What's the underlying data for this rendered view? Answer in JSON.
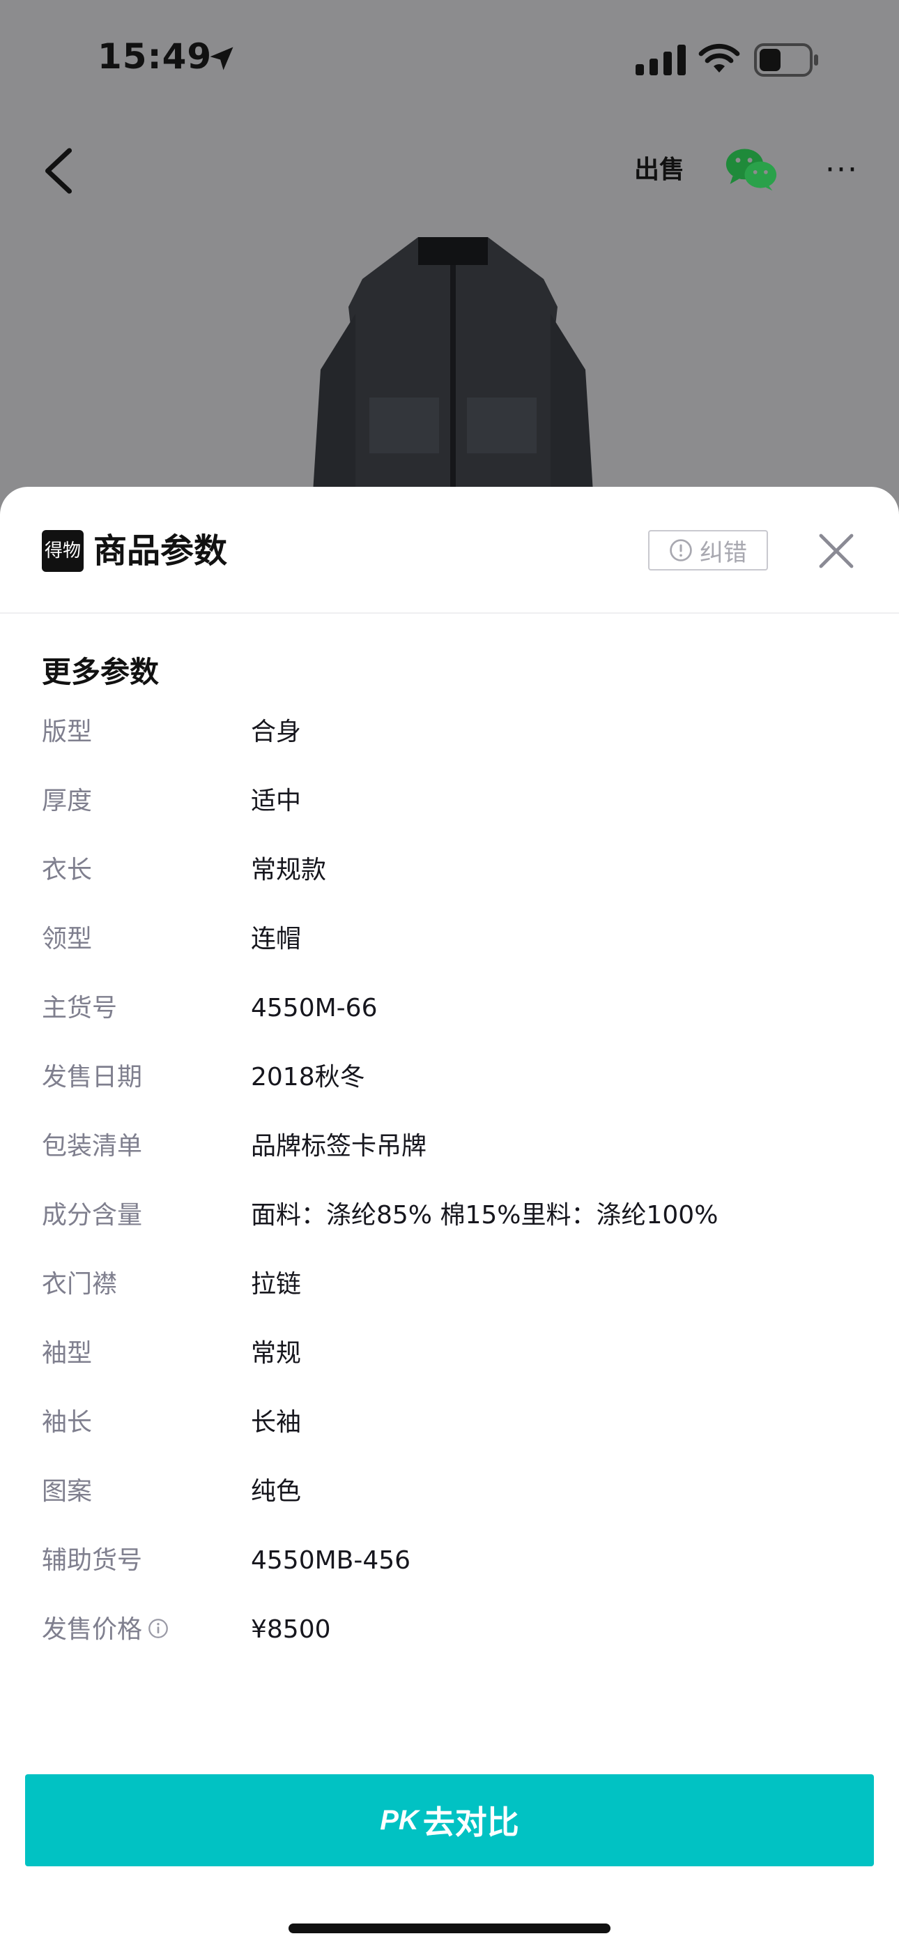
{
  "status_bar": {
    "time": "15:49"
  },
  "nav": {
    "sell_label": "出售",
    "more_label": "···"
  },
  "sheet": {
    "brand_logo_text": "得物",
    "title": "商品参数",
    "report_label": "纠错",
    "section_title": "更多参数",
    "params": [
      {
        "label": "版型",
        "value": "合身"
      },
      {
        "label": "厚度",
        "value": "适中"
      },
      {
        "label": "衣长",
        "value": "常规款"
      },
      {
        "label": "领型",
        "value": "连帽"
      },
      {
        "label": "主货号",
        "value": "4550M-66"
      },
      {
        "label": "发售日期",
        "value": "2018秋冬"
      },
      {
        "label": "包装清单",
        "value": "品牌标签卡吊牌"
      },
      {
        "label": "成分含量",
        "value": "面料：涤纶85% 棉15%里料：涤纶100%"
      },
      {
        "label": "衣门襟",
        "value": "拉链"
      },
      {
        "label": "袖型",
        "value": "常规"
      },
      {
        "label": "袖长",
        "value": "长袖"
      },
      {
        "label": "图案",
        "value": "纯色"
      },
      {
        "label": "辅助货号",
        "value": "4550MB-456"
      },
      {
        "label": "发售价格",
        "value": "¥8500"
      }
    ]
  },
  "pk_button": {
    "mark": "PK",
    "label": "去对比"
  },
  "colors": {
    "accent": "#01c2c3",
    "overlay": "#8c8c8e",
    "label_gray": "#7f7f8e"
  }
}
